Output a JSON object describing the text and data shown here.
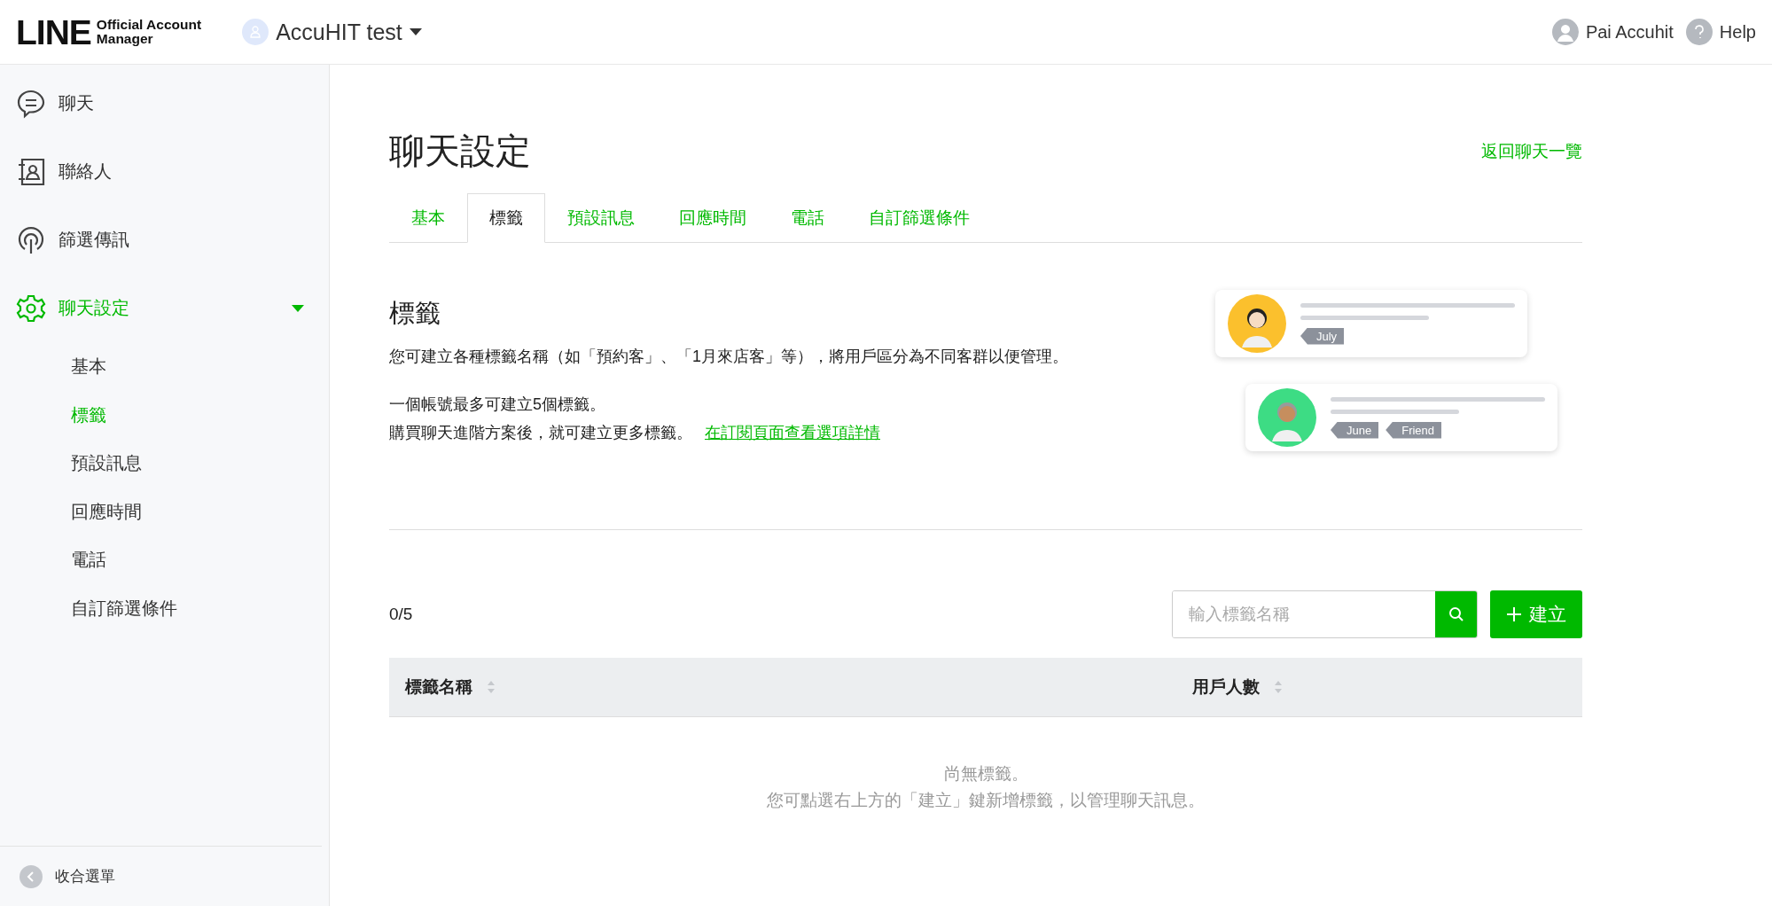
{
  "header": {
    "logo": {
      "wordmark": "LINE",
      "line_1": "Official Account",
      "line_2": "Manager"
    },
    "account": "AccuHIT test",
    "user": "Pai Accuhit",
    "help": "Help"
  },
  "sidebar": {
    "items": [
      {
        "kind": "chat",
        "label": "聊天",
        "selected": false
      },
      {
        "kind": "contacts",
        "label": "聯絡人",
        "selected": false
      },
      {
        "kind": "broadcast",
        "label": "篩選傳訊",
        "selected": false
      },
      {
        "kind": "settings",
        "label": "聊天設定",
        "selected": true,
        "expanded": true,
        "children": [
          {
            "label": "基本",
            "selected": false
          },
          {
            "label": "標籤",
            "selected": true
          },
          {
            "label": "預設訊息",
            "selected": false
          },
          {
            "label": "回應時間",
            "selected": false
          },
          {
            "label": "電話",
            "selected": false
          },
          {
            "label": "自訂篩選條件",
            "selected": false
          }
        ]
      }
    ],
    "collapse": "收合選單"
  },
  "page": {
    "title": "聊天設定",
    "back_link": "返回聊天一覽",
    "tabs": [
      {
        "label": "基本",
        "selected": false
      },
      {
        "label": "標籤",
        "selected": true
      },
      {
        "label": "預設訊息",
        "selected": false
      },
      {
        "label": "回應時間",
        "selected": false
      },
      {
        "label": "電話",
        "selected": false
      },
      {
        "label": "自訂篩選條件",
        "selected": false
      }
    ],
    "section": {
      "heading": "標籤",
      "description": "您可建立各種標籤名稱（如「預約客」、「1月來店客」等），將用戶區分為不同客群以便管理。",
      "limit": "一個帳號最多可建立5個標籤。",
      "upgrade": "購買聊天進階方案後，就可建立更多標籤。",
      "link": "在訂閱頁面查看選項詳情"
    },
    "illustration": [
      {
        "kind": "woman",
        "color": "#fbc02d",
        "tags": [
          "July"
        ]
      },
      {
        "kind": "man",
        "color": "#3ddc84",
        "tags": [
          "June",
          "Friend"
        ]
      }
    ],
    "count": "0/5",
    "search": {
      "placeholder": "輸入標籤名稱"
    },
    "create_button": "建立",
    "table": {
      "columns": [
        "標籤名稱",
        "用戶人數"
      ]
    },
    "empty": [
      "尚無標籤。",
      "您可點選右上方的「建立」鍵新增標籤，以管理聊天訊息。"
    ]
  }
}
